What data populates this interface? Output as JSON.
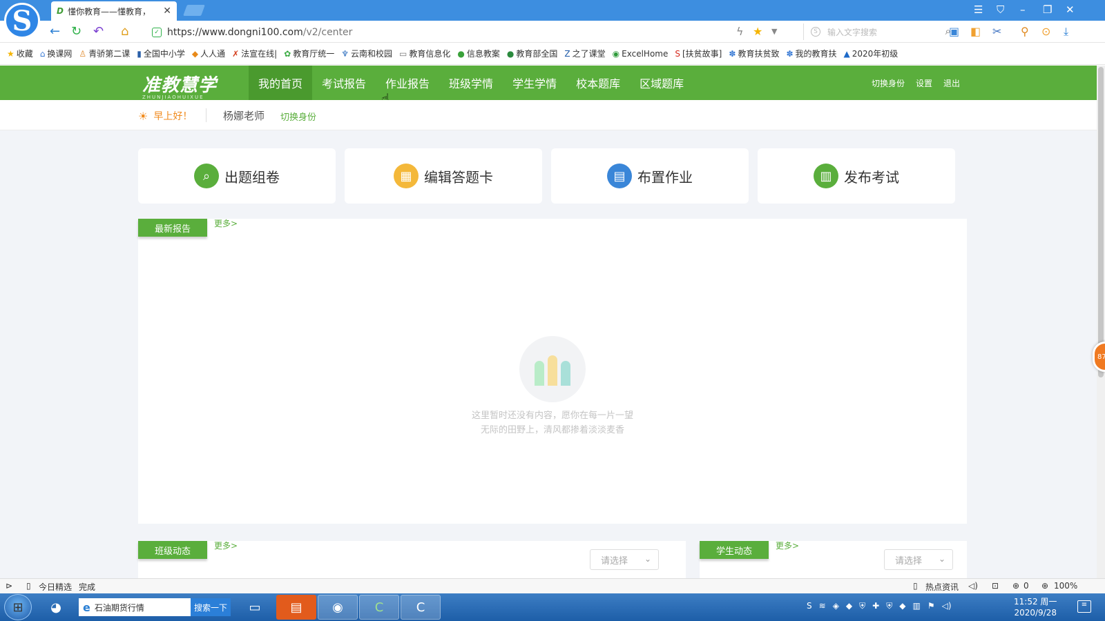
{
  "browser": {
    "tab_favicon": "D",
    "tab_title": "懂你教育——懂教育，",
    "url_base": "https://www.dongni100.com",
    "url_path": "/v2/center",
    "search_placeholder": "输入文字搜索",
    "search_engine_letter": "S"
  },
  "bookmarks": [
    {
      "icon": "★",
      "label": "收藏",
      "color": "#f5b400"
    },
    {
      "icon": "⌂",
      "label": "换课网",
      "color": "#3a7bd5"
    },
    {
      "icon": "♙",
      "label": "青骄第二课",
      "color": "#e0892a"
    },
    {
      "icon": "▮",
      "label": "全国中小学",
      "color": "#2a5fa8"
    },
    {
      "icon": "◆",
      "label": "人人通",
      "color": "#e88a1a"
    },
    {
      "icon": "✗",
      "label": "法宣在线|",
      "color": "#d43f1e"
    },
    {
      "icon": "✿",
      "label": "教育厅统一",
      "color": "#3bab44"
    },
    {
      "icon": "♆",
      "label": "云南和校园",
      "color": "#2f6fbf"
    },
    {
      "icon": "▭",
      "label": "教育信息化",
      "color": "#777"
    },
    {
      "icon": "●",
      "label": "信息教案",
      "color": "#3aa13a"
    },
    {
      "icon": "●",
      "label": "教育部全国",
      "color": "#2b8a3e"
    },
    {
      "icon": "Z",
      "label": "之了课堂",
      "color": "#1e5aa8"
    },
    {
      "icon": "◉",
      "label": "ExcelHome",
      "color": "#2e9a3a"
    },
    {
      "icon": "S",
      "label": "[扶贫故事]",
      "color": "#d62a1e"
    },
    {
      "icon": "✽",
      "label": "教育扶贫致",
      "color": "#3a7bd5"
    },
    {
      "icon": "✽",
      "label": "我的教育扶",
      "color": "#3a7bd5"
    },
    {
      "icon": "▲",
      "label": "2020年初级",
      "color": "#1e6ac8"
    }
  ],
  "site": {
    "logo_main": "准教慧学",
    "logo_sub": "ZHUNJIAOHUIXUE",
    "menu": [
      "我的首页",
      "考试报告",
      "作业报告",
      "班级学情",
      "学生学情",
      "校本题库",
      "区域题库"
    ],
    "right_links": [
      "切换身份",
      "设置",
      "退出"
    ],
    "greeting": "早上好！",
    "teacher_name": "杨娜老师",
    "switch_identity": "切换身份"
  },
  "actions": [
    {
      "label": "出题组卷",
      "icon": "search-icon",
      "glyph": "⌕",
      "color": "#5aae3c"
    },
    {
      "label": "编辑答题卡",
      "icon": "card-icon",
      "glyph": "▦",
      "color": "#f4b83a"
    },
    {
      "label": "布置作业",
      "icon": "homework-icon",
      "glyph": "▤",
      "color": "#3a86d8"
    },
    {
      "label": "发布考试",
      "icon": "exam-icon",
      "glyph": "▥",
      "color": "#5aae3c"
    }
  ],
  "latest_reports": {
    "tag": "最新报告",
    "more": "更多>",
    "empty_line1": "这里暂时还没有内容，愿你在每一片一望",
    "empty_line2": "无际的田野上，清风都掺着淡淡麦香"
  },
  "class_activity": {
    "tag": "班级动态",
    "more": "更多>",
    "select_placeholder": "请选择"
  },
  "student_activity": {
    "tag": "学生动态",
    "more": "更多>",
    "select_placeholder": "请选择"
  },
  "float_badge": "87",
  "statusbar": {
    "today": "今日精选",
    "status": "完成",
    "hot_news": "热点资讯",
    "download_count": "0",
    "zoom": "100%"
  },
  "taskbar": {
    "search_text": "石油期货行情",
    "search_button": "搜索一下",
    "time": "11:52 周一",
    "date": "2020/9/28"
  }
}
